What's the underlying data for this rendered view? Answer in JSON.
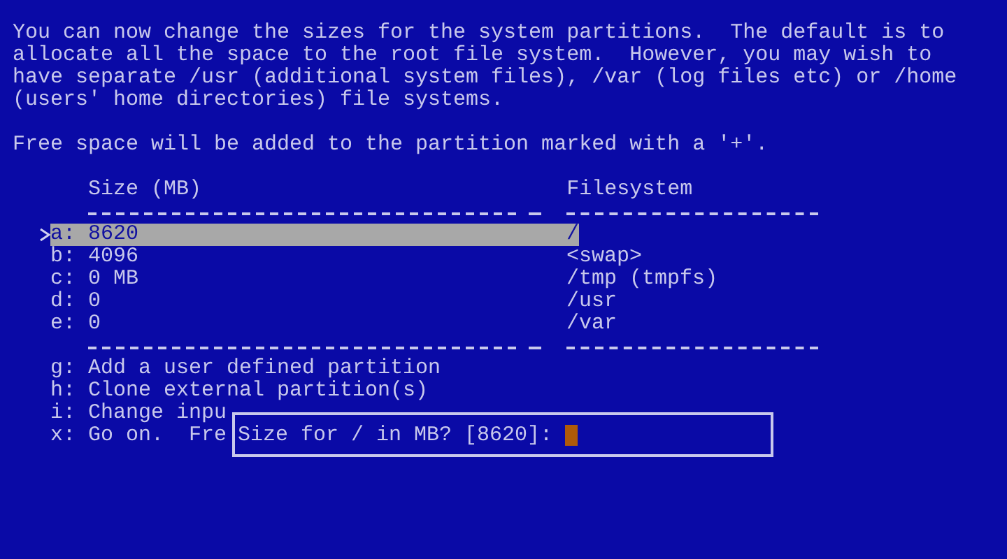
{
  "intro_lines": [
    "You can now change the sizes for the system partitions.  The default is to",
    "allocate all the space to the root file system.  However, you may wish to",
    "have separate /usr (additional system files), /var (log files etc) or /home",
    "(users' home directories) file systems."
  ],
  "note": "Free space will be added to the partition marked with a '+'.",
  "table": {
    "columns": [
      "Size (MB)",
      "Filesystem"
    ],
    "rows": [
      {
        "key": "a:",
        "size": "8620",
        "filesystem": "/",
        "selected": true
      },
      {
        "key": "b:",
        "size": "4096",
        "filesystem": "<swap>",
        "selected": false
      },
      {
        "key": "c:",
        "size": "0 MB",
        "filesystem": "/tmp (tmpfs)",
        "selected": false
      },
      {
        "key": "d:",
        "size": "0",
        "filesystem": "/usr",
        "selected": false
      },
      {
        "key": "e:",
        "size": "0",
        "filesystem": "/var",
        "selected": false
      }
    ]
  },
  "actions": [
    {
      "key": "g:",
      "label": "Add a user defined partition"
    },
    {
      "key": "h:",
      "label": "Clone external partition(s)"
    },
    {
      "key": "i:",
      "label": "Change inpu"
    },
    {
      "key": "x:",
      "label": "Go on.  Fre"
    }
  ],
  "dialog": {
    "prompt": "Size for / in MB? [8620]:"
  }
}
